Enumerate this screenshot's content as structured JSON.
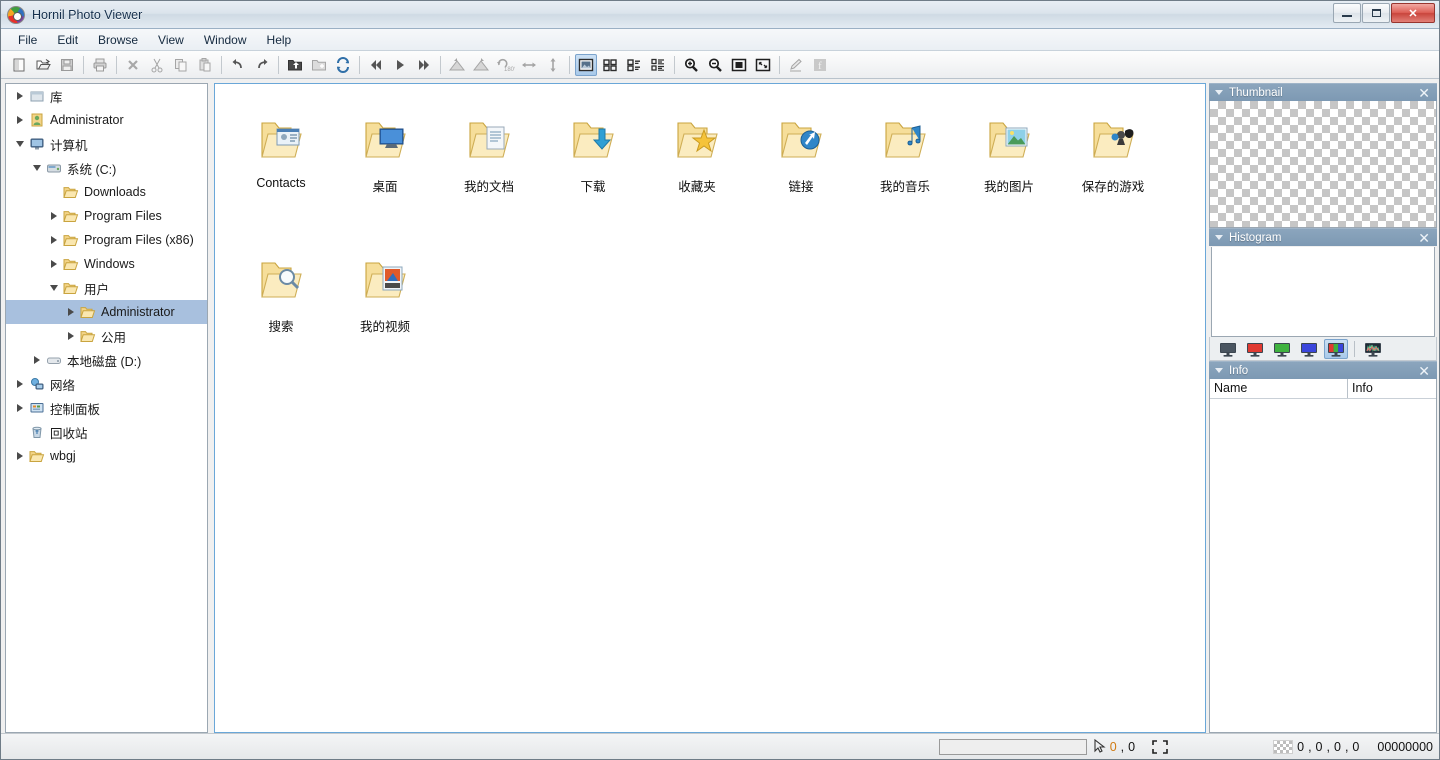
{
  "window": {
    "title": "Hornil Photo Viewer",
    "app_icon": "app-logo-icon",
    "minimize_label": "",
    "maximize_label": "",
    "close_label": "✕"
  },
  "menubar": {
    "items": [
      {
        "label": "File"
      },
      {
        "label": "Edit"
      },
      {
        "label": "Browse"
      },
      {
        "label": "View"
      },
      {
        "label": "Window"
      },
      {
        "label": "Help"
      }
    ]
  },
  "toolbar": {
    "groups": [
      {
        "buttons": [
          {
            "name": "new-icon",
            "enabled": true
          },
          {
            "name": "open-folder-icon",
            "enabled": true
          },
          {
            "name": "save-icon",
            "enabled": false
          }
        ]
      },
      {
        "buttons": [
          {
            "name": "print-icon",
            "enabled": false
          }
        ]
      },
      {
        "buttons": [
          {
            "name": "delete-icon",
            "enabled": false
          },
          {
            "name": "cut-icon",
            "enabled": false
          },
          {
            "name": "copy-icon",
            "enabled": false
          },
          {
            "name": "paste-icon",
            "enabled": false
          }
        ]
      },
      {
        "buttons": [
          {
            "name": "undo-icon",
            "enabled": true
          },
          {
            "name": "redo-icon",
            "enabled": true
          }
        ]
      },
      {
        "buttons": [
          {
            "name": "parent-folder-icon",
            "enabled": true
          },
          {
            "name": "new-folder-icon",
            "enabled": false
          },
          {
            "name": "refresh-icon",
            "enabled": true
          }
        ]
      },
      {
        "buttons": [
          {
            "name": "first-image-icon",
            "enabled": true
          },
          {
            "name": "next-image-icon",
            "enabled": true
          },
          {
            "name": "last-image-icon",
            "enabled": true
          }
        ]
      },
      {
        "buttons": [
          {
            "name": "rotate-left-icon",
            "enabled": false
          },
          {
            "name": "rotate-right-icon",
            "enabled": false
          },
          {
            "name": "rotate-180-icon",
            "enabled": false
          },
          {
            "name": "flip-horizontal-icon",
            "enabled": false
          },
          {
            "name": "flip-vertical-icon",
            "enabled": false
          }
        ]
      },
      {
        "buttons": [
          {
            "name": "view-thumbnail-icon",
            "enabled": true,
            "selected": true
          },
          {
            "name": "view-tiles-icon",
            "enabled": true
          },
          {
            "name": "view-list-icon",
            "enabled": true
          },
          {
            "name": "view-details-icon",
            "enabled": true
          }
        ]
      },
      {
        "buttons": [
          {
            "name": "zoom-in-icon",
            "enabled": true
          },
          {
            "name": "zoom-out-icon",
            "enabled": true
          },
          {
            "name": "actual-size-icon",
            "enabled": true
          },
          {
            "name": "fit-to-window-icon",
            "enabled": true
          }
        ]
      },
      {
        "buttons": [
          {
            "name": "edit-image-icon",
            "enabled": false
          },
          {
            "name": "facebook-share-icon",
            "enabled": false
          }
        ]
      }
    ]
  },
  "tree": {
    "nodes": [
      {
        "label": "库",
        "icon": "library-icon",
        "indent": 0,
        "twisty": "closed"
      },
      {
        "label": "Administrator",
        "icon": "user-icon",
        "indent": 0,
        "twisty": "closed"
      },
      {
        "label": "计算机",
        "icon": "computer-icon",
        "indent": 0,
        "twisty": "open"
      },
      {
        "label": "系统 (C:)",
        "icon": "harddisk-icon",
        "indent": 1,
        "twisty": "open"
      },
      {
        "label": "Downloads",
        "icon": "folder-icon",
        "indent": 2,
        "twisty": "none"
      },
      {
        "label": "Program Files",
        "icon": "folder-icon",
        "indent": 2,
        "twisty": "closed"
      },
      {
        "label": "Program Files (x86)",
        "icon": "folder-icon",
        "indent": 2,
        "twisty": "closed"
      },
      {
        "label": "Windows",
        "icon": "folder-icon",
        "indent": 2,
        "twisty": "closed"
      },
      {
        "label": "用户",
        "icon": "folder-icon",
        "indent": 2,
        "twisty": "open"
      },
      {
        "label": "Administrator",
        "icon": "folder-icon",
        "indent": 3,
        "twisty": "closed",
        "selected": true
      },
      {
        "label": "公用",
        "icon": "folder-icon",
        "indent": 3,
        "twisty": "closed"
      },
      {
        "label": "本地磁盘 (D:)",
        "icon": "localdisk-icon",
        "indent": 1,
        "twisty": "closed"
      },
      {
        "label": "网络",
        "icon": "network-icon",
        "indent": 0,
        "twisty": "closed"
      },
      {
        "label": "控制面板",
        "icon": "control-panel-icon",
        "indent": 0,
        "twisty": "closed"
      },
      {
        "label": "回收站",
        "icon": "recycle-bin-icon",
        "indent": 0,
        "twisty": "none"
      },
      {
        "label": "wbgj",
        "icon": "folder-icon",
        "indent": 0,
        "twisty": "closed"
      }
    ]
  },
  "content": {
    "items": [
      {
        "label": "Contacts",
        "icon": "folder-contacts-icon"
      },
      {
        "label": "桌面",
        "icon": "folder-desktop-icon"
      },
      {
        "label": "我的文档",
        "icon": "folder-documents-icon"
      },
      {
        "label": "下载",
        "icon": "folder-downloads-icon"
      },
      {
        "label": "收藏夹",
        "icon": "folder-favorites-icon"
      },
      {
        "label": "链接",
        "icon": "folder-links-icon"
      },
      {
        "label": "我的音乐",
        "icon": "folder-music-icon"
      },
      {
        "label": "我的图片",
        "icon": "folder-pictures-icon"
      },
      {
        "label": "保存的游戏",
        "icon": "folder-savedgames-icon"
      },
      {
        "label": "搜索",
        "icon": "folder-searches-icon"
      },
      {
        "label": "我的视频",
        "icon": "folder-videos-icon"
      }
    ]
  },
  "panels": {
    "thumbnail": {
      "title": "Thumbnail",
      "close_label": "✕"
    },
    "histogram": {
      "title": "Histogram",
      "close_label": "✕",
      "channels": [
        {
          "name": "histogram-luminance-button",
          "color": "#4a5560",
          "selected": false
        },
        {
          "name": "histogram-red-button",
          "color": "#e03a32",
          "selected": false
        },
        {
          "name": "histogram-green-button",
          "color": "#3fb23f",
          "selected": false
        },
        {
          "name": "histogram-blue-button",
          "color": "#3a46dc",
          "selected": false
        },
        {
          "name": "histogram-rgb-button",
          "color": "#rgb",
          "selected": true
        },
        {
          "name": "histogram-all-channels-button",
          "color": "#multi",
          "selected": false
        }
      ]
    },
    "info": {
      "title": "Info",
      "close_label": "✕",
      "columns": [
        "Name",
        "Info"
      ],
      "rows": []
    }
  },
  "statusbar": {
    "message": "",
    "cursor_x": "0",
    "cursor_y": "0",
    "separator": ",",
    "fit_icon": "fit-screen-icon",
    "color_r": "0",
    "color_g": "0",
    "color_b": "0",
    "color_a": "0",
    "color_hex": "00000000"
  },
  "colors": {
    "accent": "#7d99b3",
    "selection": "#a8c0de",
    "folder": "#f2d98a",
    "status_number": "#d07a12"
  }
}
